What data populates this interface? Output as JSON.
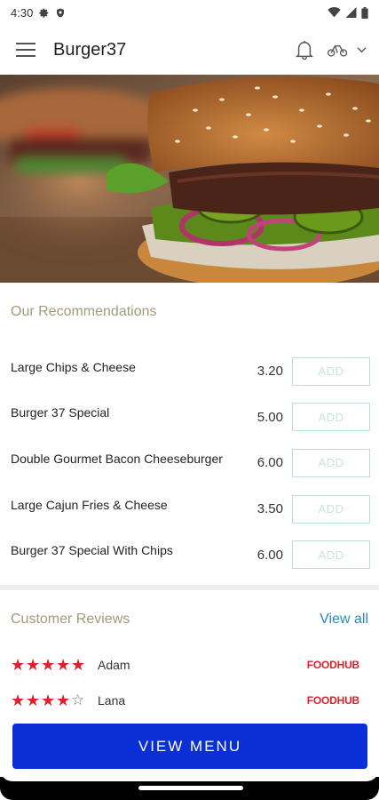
{
  "status_bar": {
    "time": "4:30",
    "icons_left": [
      "gear-icon",
      "shield-icon"
    ],
    "icons_right": [
      "wifi-icon",
      "signal-icon",
      "battery-icon"
    ]
  },
  "app_bar": {
    "title": "Burger37",
    "icons": [
      "menu-icon",
      "bell-icon",
      "bikes-icon",
      "chevron-down-icon"
    ]
  },
  "hero": {
    "description_icon": "burger-photo"
  },
  "recommendations": {
    "title": "Our Recommendations",
    "add_label": "ADD",
    "items": [
      {
        "name": "Large Chips & Cheese",
        "price": "3.20"
      },
      {
        "name": "Burger 37 Special",
        "price": "5.00"
      },
      {
        "name": "Double Gourmet Bacon Cheeseburger",
        "price": "6.00"
      },
      {
        "name": "Large Cajun Fries & Cheese",
        "price": "3.50"
      },
      {
        "name": "Burger 37 Special With Chips",
        "price": "6.00"
      }
    ]
  },
  "reviews": {
    "title": "Customer Reviews",
    "view_all": "View all",
    "items": [
      {
        "name": "Adam",
        "rating": 5,
        "source": "FOODHUB"
      },
      {
        "name": "Lana",
        "rating": 4,
        "source": "FOODHUB"
      }
    ]
  },
  "cta": {
    "label": "VIEW MENU"
  },
  "colors": {
    "accent": "#0b2fd6",
    "section_title": "#a39a7a",
    "link": "#2b88b5",
    "star": "#d8232a",
    "add_border": "#b8e0d4"
  }
}
